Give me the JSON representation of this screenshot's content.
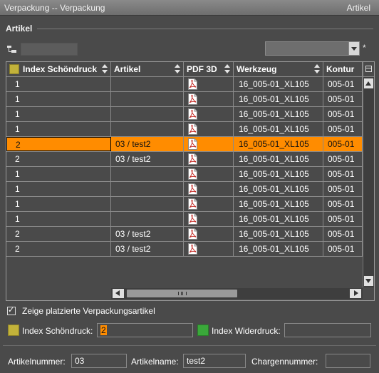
{
  "window": {
    "title": "Verpackung -- Verpackung",
    "right_title": "Artikel"
  },
  "section": {
    "label": "Artikel"
  },
  "toolbar": {
    "search_value": "",
    "combo_value": "",
    "required_mark": "*"
  },
  "table": {
    "columns": [
      {
        "label": "Index Schöndruck"
      },
      {
        "label": "Artikel"
      },
      {
        "label": "PDF 3D"
      },
      {
        "label": "Werkzeug"
      },
      {
        "label": "Kontur"
      }
    ],
    "rows": [
      {
        "index": "1",
        "artikel": "",
        "werkzeug": "16_005-01_XL105",
        "kontur": "005-01"
      },
      {
        "index": "1",
        "artikel": "",
        "werkzeug": "16_005-01_XL105",
        "kontur": "005-01"
      },
      {
        "index": "1",
        "artikel": "",
        "werkzeug": "16_005-01_XL105",
        "kontur": "005-01"
      },
      {
        "index": "1",
        "artikel": "",
        "werkzeug": "16_005-01_XL105",
        "kontur": "005-01"
      },
      {
        "index": "2",
        "artikel": "03 / test2",
        "werkzeug": "16_005-01_XL105",
        "kontur": "005-01",
        "selected": true
      },
      {
        "index": "2",
        "artikel": "03 / test2",
        "werkzeug": "16_005-01_XL105",
        "kontur": "005-01"
      },
      {
        "index": "1",
        "artikel": "",
        "werkzeug": "16_005-01_XL105",
        "kontur": "005-01"
      },
      {
        "index": "1",
        "artikel": "",
        "werkzeug": "16_005-01_XL105",
        "kontur": "005-01"
      },
      {
        "index": "1",
        "artikel": "",
        "werkzeug": "16_005-01_XL105",
        "kontur": "005-01"
      },
      {
        "index": "1",
        "artikel": "",
        "werkzeug": "16_005-01_XL105",
        "kontur": "005-01"
      },
      {
        "index": "2",
        "artikel": "03 / test2",
        "werkzeug": "16_005-01_XL105",
        "kontur": "005-01"
      },
      {
        "index": "2",
        "artikel": "03 / test2",
        "werkzeug": "16_005-01_XL105",
        "kontur": "005-01"
      }
    ]
  },
  "options": {
    "show_placed_label": "Zeige platzierte Verpackungsartikel",
    "show_placed_checked": true
  },
  "print_index": {
    "schoendruck_label": "Index Schöndruck:",
    "schoendruck_value": "2",
    "widerdruck_label": "Index Widerdruck:",
    "widerdruck_value": ""
  },
  "article_fields": {
    "number_label": "Artikelnummer:",
    "number_value": "03",
    "name_label": "Artikelname:",
    "name_value": "test2",
    "batch_label": "Chargennummer:",
    "batch_value": ""
  },
  "colors": {
    "selection": "#ff8c00",
    "schoendruck_swatch": "#c2b23a",
    "widerdruck_swatch": "#3aa83a"
  }
}
